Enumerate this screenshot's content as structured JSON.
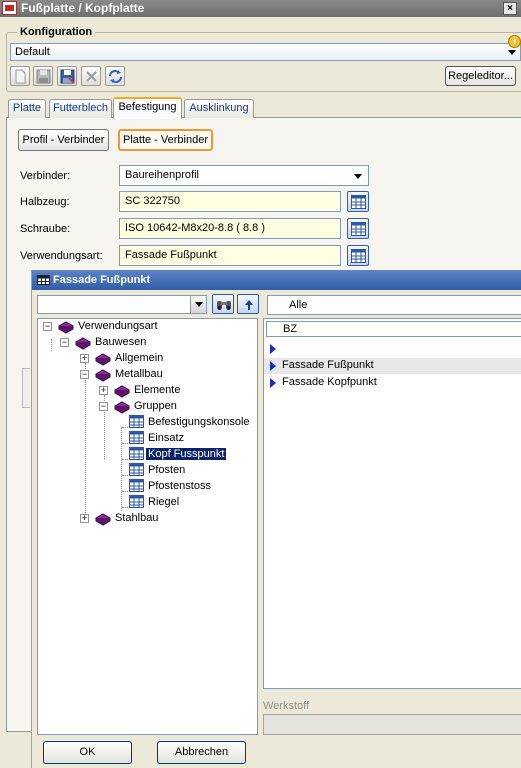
{
  "window": {
    "title": "Fußplatte / Kopfplatte",
    "close_glyph": "×"
  },
  "konfiguration": {
    "legend": "Konfiguration",
    "value": "Default",
    "info_glyph": "i",
    "toolbar_icons": [
      "new-document-icon",
      "save-icon",
      "save-as-icon",
      "delete-icon",
      "refresh-icon"
    ],
    "regeleditor_label": "Regeleditor..."
  },
  "tabs": [
    {
      "label": "Platte",
      "active": false
    },
    {
      "label": "Futterblech",
      "active": false
    },
    {
      "label": "Befestigung",
      "active": true
    },
    {
      "label": "Ausklinkung",
      "active": false
    }
  ],
  "befestigung": {
    "profil_button": "Profil - Verbinder",
    "platte_button": "Platte - Verbinder",
    "fields": {
      "verbinder": {
        "label": "Verbinder:",
        "value": "Baureihenprofil"
      },
      "halbzeug": {
        "label": "Halbzeug:",
        "value": "SC  322750"
      },
      "schraube": {
        "label": "Schraube:",
        "value": "ISO 10642-M8x20-8.8  ( 8.8 )"
      },
      "verwendungsart": {
        "label": "Verwendungsart:",
        "value": "Fassade Fußpunkt"
      }
    }
  },
  "dialog": {
    "title": "Fassade Fußpunkt",
    "filter_value": "",
    "search_field_value": "Alle",
    "tree": [
      {
        "label": "Verwendungsart",
        "expander": "−",
        "icon": "book-icon"
      },
      {
        "label": "Bauwesen",
        "expander": "−",
        "icon": "book-icon"
      },
      {
        "label": "Allgemein",
        "expander": "+",
        "icon": "book-icon"
      },
      {
        "label": "Metallbau",
        "expander": "−",
        "icon": "book-icon"
      },
      {
        "label": "Elemente",
        "expander": "+",
        "icon": "book-icon"
      },
      {
        "label": "Gruppen",
        "expander": "−",
        "icon": "book-icon"
      },
      {
        "label": "Befestigungskonsole",
        "icon": "table-icon"
      },
      {
        "label": "Einsatz",
        "icon": "table-icon"
      },
      {
        "label": "Kopf Fusspunkt",
        "icon": "table-icon",
        "selected": true
      },
      {
        "label": "Pfosten",
        "icon": "table-icon"
      },
      {
        "label": "Pfostenstoss",
        "icon": "table-icon"
      },
      {
        "label": "Riegel",
        "icon": "table-icon"
      },
      {
        "label": "Stahlbau",
        "expander": "+",
        "icon": "book-icon"
      }
    ],
    "list_header": "BZ",
    "list_rows": [
      {
        "label": ""
      },
      {
        "label": "Fassade Fußpunkt",
        "highlight": true
      },
      {
        "label": "Fassade Kopfpunkt"
      }
    ],
    "werkstoff_label": "Werkstoff",
    "ok_label": "OK",
    "cancel_label": "Abbrechen"
  }
}
